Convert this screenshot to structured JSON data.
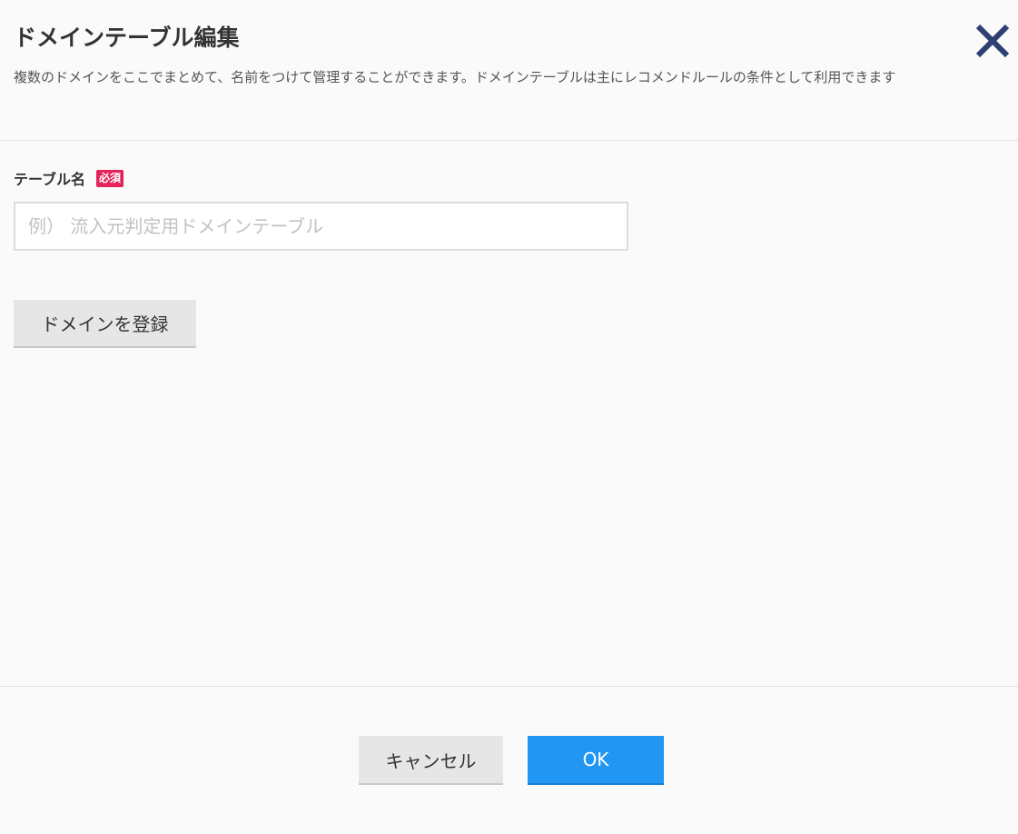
{
  "dialog": {
    "title": "ドメインテーブル編集",
    "description": "複数のドメインをここでまとめて、名前をつけて管理することができます。ドメインテーブルは主にレコメンドルールの条件として利用できます",
    "close_icon": "close-icon"
  },
  "form": {
    "table_name_label": "テーブル名",
    "required_badge": "必須",
    "table_name_value": "",
    "table_name_placeholder": "例） 流入元判定用ドメインテーブル",
    "register_domain_label": "ドメインを登録"
  },
  "footer": {
    "cancel_label": "キャンセル",
    "ok_label": "OK"
  },
  "colors": {
    "close_icon": "#2e3f73",
    "required_badge": "#e3245a",
    "ok_button": "#2196f3",
    "secondary_button": "#e6e6e6",
    "background": "#fafafa"
  }
}
